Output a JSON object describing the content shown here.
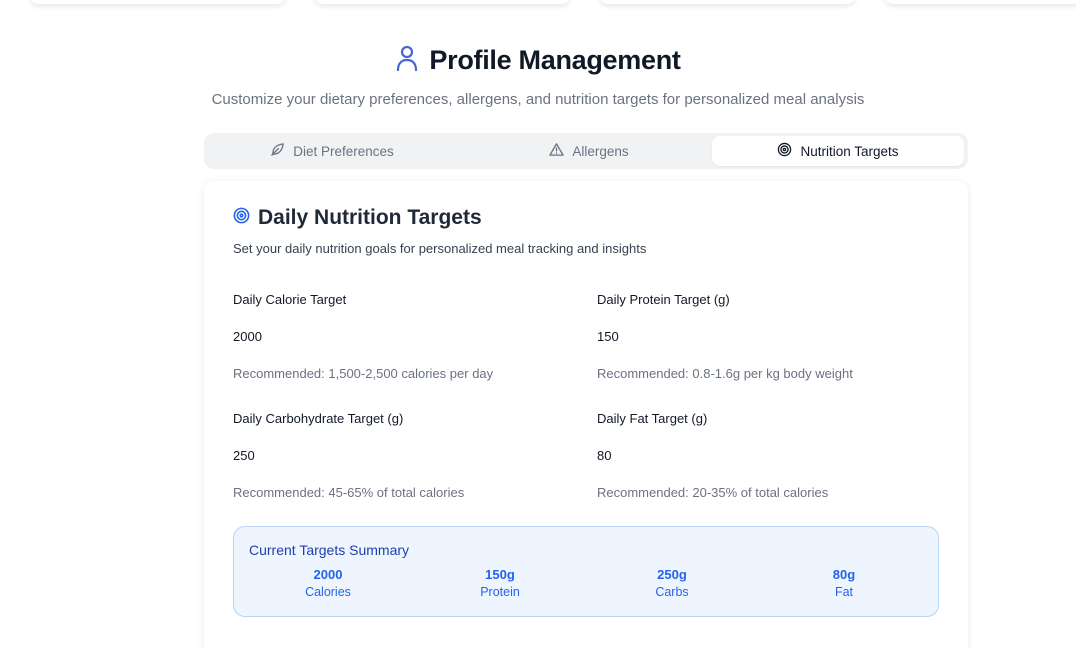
{
  "header": {
    "title": "Profile Management",
    "subtitle": "Customize your dietary preferences, allergens, and nutrition targets for personalized meal analysis",
    "icon": "user-icon"
  },
  "tabs": [
    {
      "label": "Diet Preferences",
      "icon": "leaf-icon",
      "active": false
    },
    {
      "label": "Allergens",
      "icon": "warning-triangle-icon",
      "active": false
    },
    {
      "label": "Nutrition Targets",
      "icon": "target-icon",
      "active": true
    }
  ],
  "card": {
    "title": "Daily Nutrition Targets",
    "description": "Set your daily nutrition goals for personalized meal tracking and insights",
    "icon": "target-icon"
  },
  "fields": {
    "calories": {
      "label": "Daily Calorie Target",
      "value": "2000",
      "hint": "Recommended: 1,500-2,500 calories per day"
    },
    "protein": {
      "label": "Daily Protein Target (g)",
      "value": "150",
      "hint": "Recommended: 0.8-1.6g per kg body weight"
    },
    "carbs": {
      "label": "Daily Carbohydrate Target (g)",
      "value": "250",
      "hint": "Recommended: 45-65% of total calories"
    },
    "fat": {
      "label": "Daily Fat Target (g)",
      "value": "80",
      "hint": "Recommended: 20-35% of total calories"
    }
  },
  "summary": {
    "title": "Current Targets Summary",
    "items": [
      {
        "value": "2000",
        "label": "Calories"
      },
      {
        "value": "150g",
        "label": "Protein"
      },
      {
        "value": "250g",
        "label": "Carbs"
      },
      {
        "value": "80g",
        "label": "Fat"
      }
    ]
  },
  "colors": {
    "accent": "#2563eb",
    "summary_background": "#eef5fe",
    "summary_border": "#b9d4f4"
  }
}
